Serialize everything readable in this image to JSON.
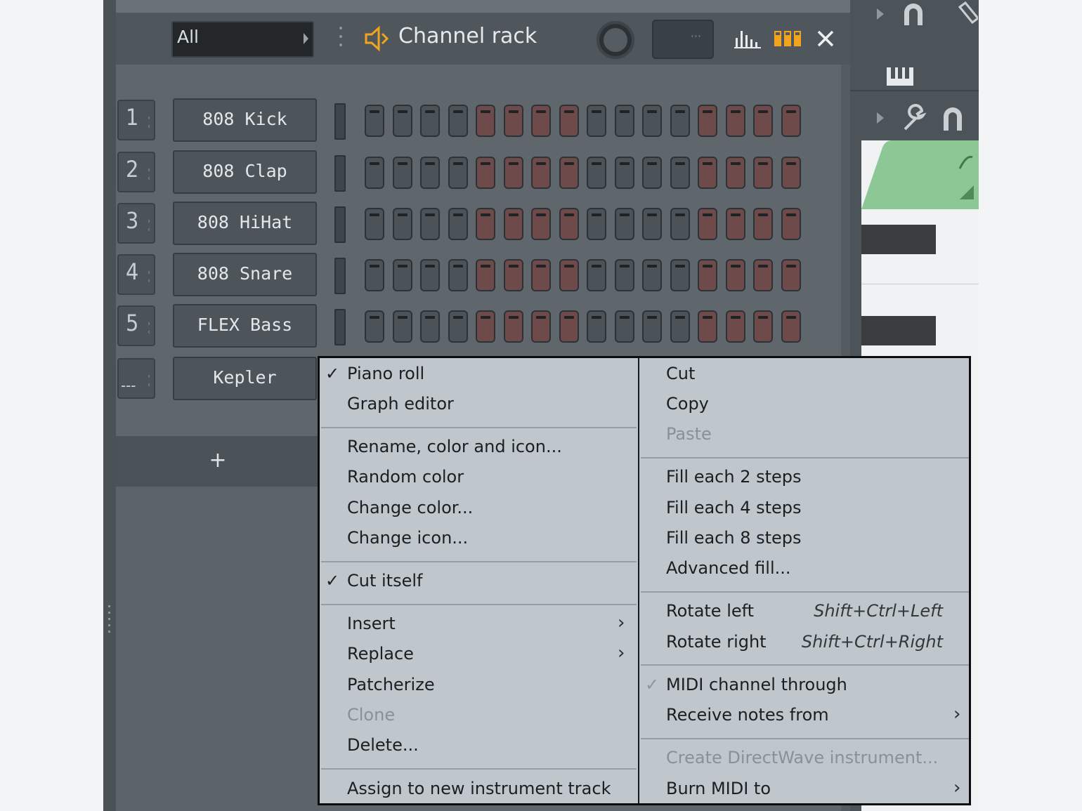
{
  "header": {
    "filter_value": "All",
    "title": "Channel rack",
    "swing_value": "···"
  },
  "channels": [
    {
      "num": "1",
      "name": "808 Kick"
    },
    {
      "num": "2",
      "name": "808 Clap"
    },
    {
      "num": "3",
      "name": "808 HiHat"
    },
    {
      "num": "4",
      "name": "808 Snare"
    },
    {
      "num": "5",
      "name": "FLEX Bass"
    },
    {
      "num": "---",
      "name": "Kepler"
    }
  ],
  "steps_per_pattern": 16,
  "step_color_groups": [
    "grey",
    "red",
    "grey",
    "red"
  ],
  "add_channel_label": "+",
  "colors": {
    "accent_orange": "#f2a51c",
    "step_red": "#6e4a4a",
    "step_grey": "#4b5258",
    "menu_bg": "#bfc6cc",
    "piano_note_green": "#8ec796"
  },
  "context_menu": {
    "left": [
      {
        "label": "Piano roll",
        "checked": true
      },
      {
        "label": "Graph editor"
      },
      {
        "label": "Rename, color and icon..."
      },
      {
        "label": "Random color"
      },
      {
        "label": "Change color..."
      },
      {
        "label": "Change icon..."
      },
      {
        "label": "Cut itself",
        "checked": true
      },
      {
        "label": "Insert",
        "submenu": true
      },
      {
        "label": "Replace",
        "submenu": true
      },
      {
        "label": "Patcherize"
      },
      {
        "label": "Clone",
        "disabled": true
      },
      {
        "label": "Delete..."
      },
      {
        "label": "Assign to new instrument track"
      }
    ],
    "right": [
      {
        "label": "Cut"
      },
      {
        "label": "Copy"
      },
      {
        "label": "Paste",
        "disabled": true
      },
      {
        "label": "Fill each 2 steps"
      },
      {
        "label": "Fill each 4 steps"
      },
      {
        "label": "Fill each 8 steps"
      },
      {
        "label": "Advanced fill..."
      },
      {
        "label": "Rotate left",
        "shortcut": "Shift+Ctrl+Left"
      },
      {
        "label": "Rotate right",
        "shortcut": "Shift+Ctrl+Right"
      },
      {
        "label": "MIDI channel through",
        "checked": true,
        "check_disabled": true
      },
      {
        "label": "Receive notes from",
        "submenu": true
      },
      {
        "label": "Create DirectWave instrument...",
        "disabled": true
      },
      {
        "label": "Burn MIDI to",
        "submenu": true
      }
    ]
  }
}
